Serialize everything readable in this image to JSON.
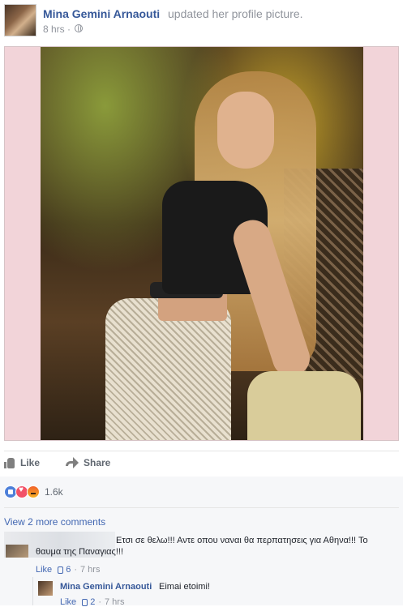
{
  "post": {
    "author": "Mina Gemini Arnaouti",
    "action": "updated her profile picture.",
    "time": "8 hrs",
    "separator": "·",
    "privacy_icon": "globe-icon"
  },
  "actions": {
    "like_label": "Like",
    "share_label": "Share"
  },
  "reactions": {
    "icons": [
      "like-reaction",
      "love-reaction",
      "angry-reaction"
    ],
    "count": "1.6k"
  },
  "comments": {
    "view_more": "View 2 more comments",
    "items": [
      {
        "text": "Ετσι σε θελω!!! Αντε οπου ναναι θα περπατησεις για Αθηνα!!! Το θαυμα της Παναγιας!!!",
        "like_label": "Like",
        "likes": "6",
        "time": "7 hrs"
      }
    ],
    "reply": {
      "author": "Mina Gemini Arnaouti",
      "text": "Eimai etoimi!",
      "like_label": "Like",
      "likes": "2",
      "time": "7 hrs"
    }
  },
  "colors": {
    "link": "#365899",
    "meta": "#90949c",
    "like_reaction": "#4d7fd9",
    "love_reaction": "#f25268",
    "angry_reaction": "#f0612a"
  }
}
